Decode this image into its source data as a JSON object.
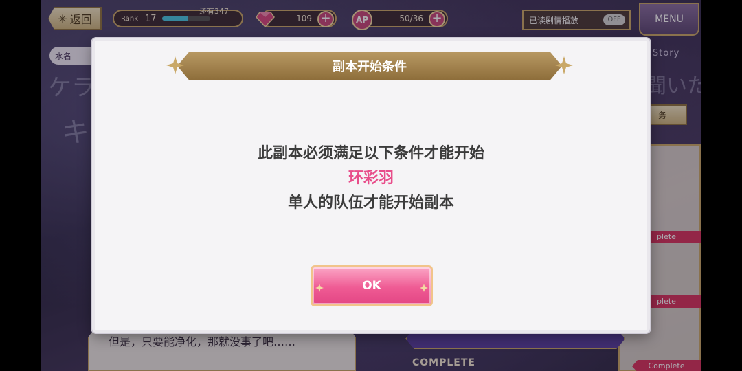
{
  "top_bar": {
    "back_label": "返回",
    "rank_label": "Rank",
    "rank_value": "17",
    "rank_remaining": "还有347",
    "rank_progress": 0.55,
    "gems": "109",
    "ap_label": "AP",
    "ap_value": "50/36",
    "autoplay_label": "已读剧情播放",
    "autoplay_state": "OFF",
    "menu_label": "MENU"
  },
  "background": {
    "side_tag": "水名",
    "story_tag": "Story",
    "mission_label": "务",
    "complete_tags": [
      "plete",
      "plete",
      "Complete"
    ],
    "complete_banner": "COMPLETE",
    "dialogue": "但是，只要能净化，那就没事了吧……"
  },
  "modal": {
    "title": "副本开始条件",
    "line1": "此副本必须满足以下条件才能开始",
    "character": "环彩羽",
    "line2": "单人的队伍才能开始副本",
    "ok_label": "OK"
  },
  "colors": {
    "accent_pink": "#e84d8a",
    "banner_gold": "#a8874f",
    "modal_bg": "#f5f4f6"
  }
}
